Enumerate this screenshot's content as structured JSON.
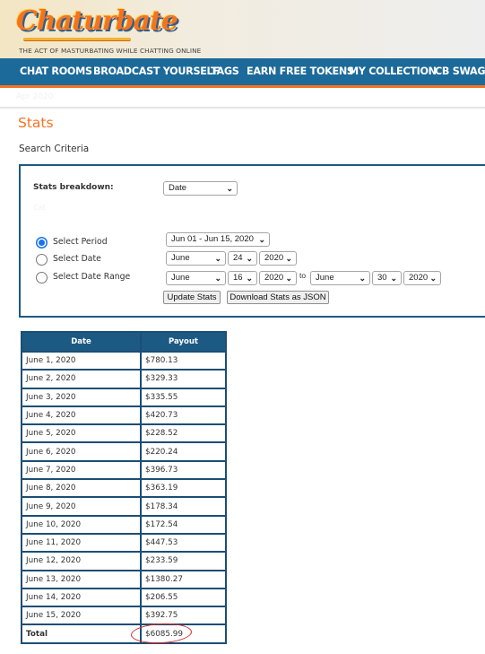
{
  "header": {
    "logo_text": "Chaturbate",
    "tagline": "THE ACT OF MASTURBATING WHILE CHATTING ONLINE"
  },
  "nav": {
    "items": [
      {
        "label": "CHAT ROOMS"
      },
      {
        "label": "BROADCAST YOURSELF"
      },
      {
        "label": "TAGS"
      },
      {
        "label": "EARN FREE TOKENS"
      },
      {
        "label": "MY COLLECTION"
      },
      {
        "label": "CB SWAG"
      }
    ]
  },
  "subbar": {
    "text": "Apr 2020"
  },
  "page": {
    "title": "Stats",
    "search_criteria": "Search Criteria"
  },
  "form": {
    "breakdown_label": "Stats breakdown:",
    "breakdown_value": "Date",
    "faint_label": "Cat",
    "radios": [
      {
        "label": "Select Period",
        "checked": true
      },
      {
        "label": "Select Date",
        "checked": false
      },
      {
        "label": "Select Date Range",
        "checked": false
      }
    ],
    "period_value": "Jun 01 - Jun 15, 2020",
    "date": {
      "month": "June",
      "day": "24",
      "year": "2020"
    },
    "range_from": {
      "month": "June",
      "day": "16",
      "year": "2020"
    },
    "range_to_label": "to",
    "range_to": {
      "month": "June",
      "day": "30",
      "year": "2020"
    },
    "update_button": "Update Stats",
    "download_button": "Download Stats as JSON",
    "chevron_icon": "chevron-down-icon"
  },
  "table": {
    "headers": [
      "Date",
      "Payout"
    ],
    "rows": [
      {
        "date": "June 1, 2020",
        "payout": "$780.13"
      },
      {
        "date": "June 2, 2020",
        "payout": "$329.33"
      },
      {
        "date": "June 3, 2020",
        "payout": "$335.55"
      },
      {
        "date": "June 4, 2020",
        "payout": "$420.73"
      },
      {
        "date": "June 5, 2020",
        "payout": "$228.52"
      },
      {
        "date": "June 6, 2020",
        "payout": "$220.24"
      },
      {
        "date": "June 7, 2020",
        "payout": "$396.73"
      },
      {
        "date": "June 8, 2020",
        "payout": "$363.19"
      },
      {
        "date": "June 9, 2020",
        "payout": "$178.34"
      },
      {
        "date": "June 10, 2020",
        "payout": "$172.54"
      },
      {
        "date": "June 11, 2020",
        "payout": "$447.53"
      },
      {
        "date": "June 12, 2020",
        "payout": "$233.59"
      },
      {
        "date": "June 13, 2020",
        "payout": "$1380.27"
      },
      {
        "date": "June 14, 2020",
        "payout": "$206.55"
      },
      {
        "date": "June 15, 2020",
        "payout": "$392.75"
      }
    ],
    "total_label": "Total",
    "total_value": "$6085.99"
  },
  "colors": {
    "nav_bg": "#1c6a9a",
    "accent_orange": "#f47321",
    "table_header": "#1c5a84",
    "annotation_red": "#d22a2a"
  }
}
